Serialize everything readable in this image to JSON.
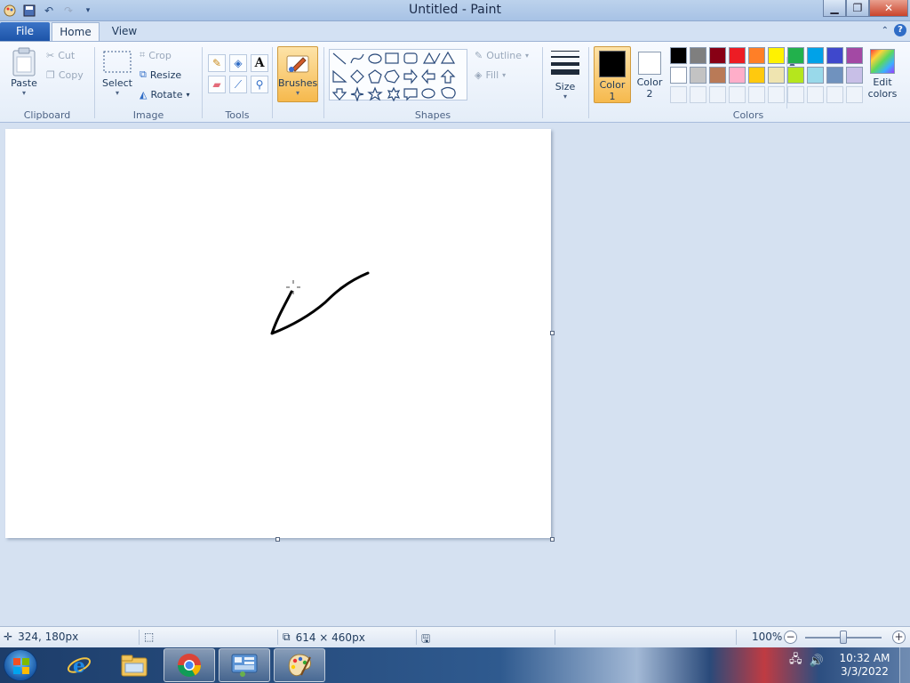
{
  "window": {
    "title": "Untitled - Paint"
  },
  "tabs": {
    "file": "File",
    "home": "Home",
    "view": "View"
  },
  "clipboard": {
    "paste": "Paste",
    "cut": "Cut",
    "copy": "Copy",
    "label": "Clipboard"
  },
  "image": {
    "select": "Select",
    "crop": "Crop",
    "resize": "Resize",
    "rotate": "Rotate",
    "label": "Image"
  },
  "tools": {
    "label": "Tools",
    "text_glyph": "A"
  },
  "brushes": {
    "label": "Brushes"
  },
  "shapes": {
    "label": "Shapes",
    "outline": "Outline",
    "fill": "Fill"
  },
  "size": {
    "label": "Size"
  },
  "colors": {
    "label": "Colors",
    "color1_label": "Color",
    "color1_num": "1",
    "color2_label": "Color",
    "color2_num": "2",
    "edit_label": "Edit",
    "edit_label2": "colors",
    "color1_value": "#000000",
    "color2_value": "#ffffff",
    "palette": [
      "#000000",
      "#7f7f7f",
      "#880015",
      "#ed1c24",
      "#ff7f27",
      "#fff200",
      "#22b14c",
      "#00a2e8",
      "#3f48cc",
      "#a349a4",
      "#ffffff",
      "#c3c3c3",
      "#b97a57",
      "#ffaec9",
      "#ffc90e",
      "#efe4b0",
      "#b5e61d",
      "#99d9ea",
      "#7092be",
      "#c8bfe7"
    ]
  },
  "statusbar": {
    "cursor_pos": "324, 180px",
    "canvas_size": "614 × 460px",
    "zoom": "100%",
    "zoom_level": 0.5
  },
  "taskbar": {
    "time": "10:32 AM",
    "date": "3/3/2022"
  }
}
